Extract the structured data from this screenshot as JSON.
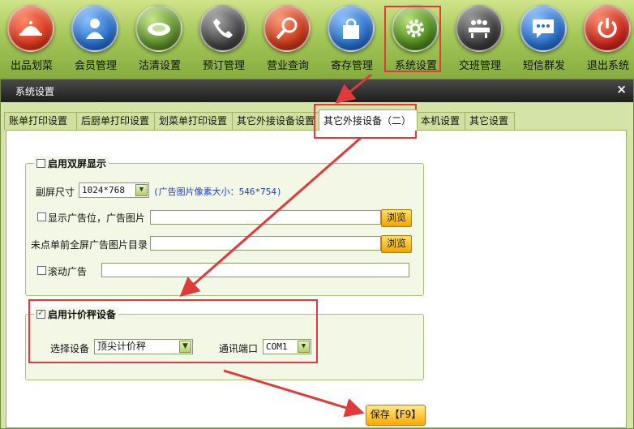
{
  "toolbar": {
    "items": [
      {
        "label": "出品划菜",
        "icon": "dish-cover-icon",
        "color": "#d93a1e"
      },
      {
        "label": "会员管理",
        "icon": "member-icon",
        "color": "#2a6fc9"
      },
      {
        "label": "沽清设置",
        "icon": "plate-icon",
        "color": "#5e8f2c"
      },
      {
        "label": "预订管理",
        "icon": "phone-icon",
        "color": "#444444"
      },
      {
        "label": "营业查询",
        "icon": "search-icon",
        "color": "#c83a1a"
      },
      {
        "label": "寄存管理",
        "icon": "shopping-bag-icon",
        "color": "#2a6fc9"
      },
      {
        "label": "系统设置",
        "icon": "gear-icon",
        "color": "#4f8a1c"
      },
      {
        "label": "交班管理",
        "icon": "meeting-icon",
        "color": "#3c3c3c"
      },
      {
        "label": "短信群发",
        "icon": "message-icon",
        "color": "#2a6fc9"
      },
      {
        "label": "退出系统",
        "icon": "power-icon",
        "color": "#c8281a"
      }
    ]
  },
  "window": {
    "title": "系统设置",
    "close_glyph": "×"
  },
  "tabs": [
    {
      "label": "账单打印设置"
    },
    {
      "label": "后厨单打印设置"
    },
    {
      "label": "划菜单打印设置"
    },
    {
      "label": "其它外接设备设置"
    },
    {
      "label": "其它外接设备（二）"
    },
    {
      "label": "本机设置"
    },
    {
      "label": "其它设置"
    }
  ],
  "dual_screen": {
    "legend": "启用双屏显示",
    "enabled": false,
    "size_label": "副屏尺寸",
    "size_value": "1024*768",
    "hint": "(广告图片像素大小：546*754)",
    "ad_position_label": "显示广告位，广告图片",
    "ad_position_checked": false,
    "ad_image_value": "",
    "browse_label": "浏览",
    "fullscreen_dir_label": "未点单前全屏广告图片目录",
    "fullscreen_dir_value": "",
    "scroll_ad_label": "滚动广告",
    "scroll_ad_checked": false,
    "scroll_ad_value": ""
  },
  "scale": {
    "legend": "启用计价秤设备",
    "enabled": true,
    "device_label": "选择设备",
    "device_value": "顶尖计价秤",
    "port_label": "通讯端口",
    "port_value": "COM1"
  },
  "save_label": "保存【F9】",
  "colors": {
    "highlight": "#e03a3a",
    "panel_bg": "#d4e3a8",
    "button_gold": "#f7aa00"
  }
}
